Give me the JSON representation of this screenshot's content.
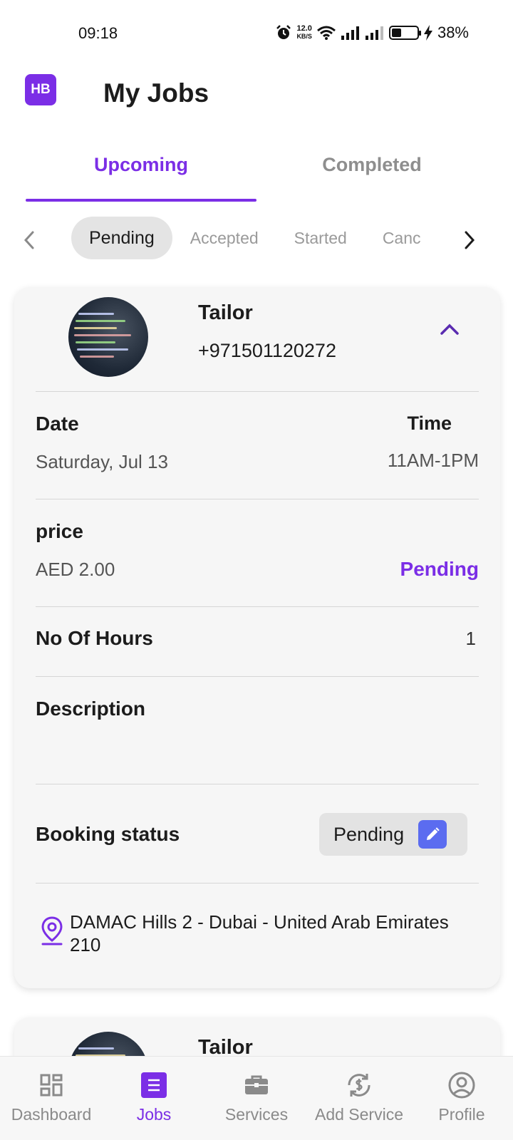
{
  "status_bar": {
    "time": "09:18",
    "speed_value": "12.0",
    "speed_unit": "KB/S",
    "battery": "38%",
    "battery_level": 0.38
  },
  "header": {
    "logo_text": "HB",
    "title": "My Jobs"
  },
  "tabs": [
    {
      "label": "Upcoming",
      "active": true
    },
    {
      "label": "Completed",
      "active": false
    }
  ],
  "filters": {
    "chips": [
      "Pending",
      "Accepted",
      "Started",
      "Canc"
    ],
    "active": "Pending"
  },
  "job": {
    "service_name": "Tailor",
    "phone": "+971501120272",
    "date_label": "Date",
    "date_value": "Saturday, Jul 13",
    "time_label": "Time",
    "time_value": "11AM-1PM",
    "price_label": "price",
    "price_value": "AED 2.00",
    "price_status": "Pending",
    "hours_label": "No Of Hours",
    "hours_value": "1",
    "description_label": "Description",
    "booking_status_label": "Booking status",
    "booking_status_value": "Pending",
    "address": "DAMAC Hills 2 - Dubai - United Arab Emirates 210"
  },
  "job2": {
    "service_name": "Tailor"
  },
  "bottom_nav": [
    {
      "label": "Dashboard",
      "icon": "dashboard-icon",
      "active": false
    },
    {
      "label": "Jobs",
      "icon": "jobs-icon",
      "active": true
    },
    {
      "label": "Services",
      "icon": "briefcase-icon",
      "active": false
    },
    {
      "label": "Add Service",
      "icon": "add-service-icon",
      "active": false
    },
    {
      "label": "Profile",
      "icon": "profile-icon",
      "active": false
    }
  ],
  "colors": {
    "accent": "#7b2ee6",
    "edit_button": "#5b6cf0",
    "muted_text": "#8e8e8e",
    "card_background": "#f6f6f6"
  }
}
